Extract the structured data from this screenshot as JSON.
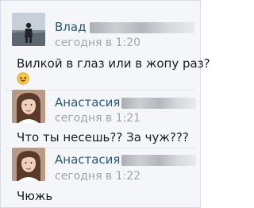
{
  "messages": [
    {
      "author_first_name": "Влад",
      "time": "сегодня в 1:20",
      "text": "Вилкой в глаз или в жопу раз?",
      "emoji": "laughing-emoji"
    },
    {
      "author_first_name": "Анастасия",
      "time": "сегодня в 1:21",
      "text": "Что ты несешь?? За чуж???"
    },
    {
      "author_first_name": "Анастасия",
      "time": "сегодня в 1:22",
      "text": "Чюжь"
    }
  ],
  "colors": {
    "author_name": "#2b587a",
    "timestamp": "#a0a6ad",
    "message_text": "#1c1c1c",
    "background": "#f4f6f9"
  }
}
